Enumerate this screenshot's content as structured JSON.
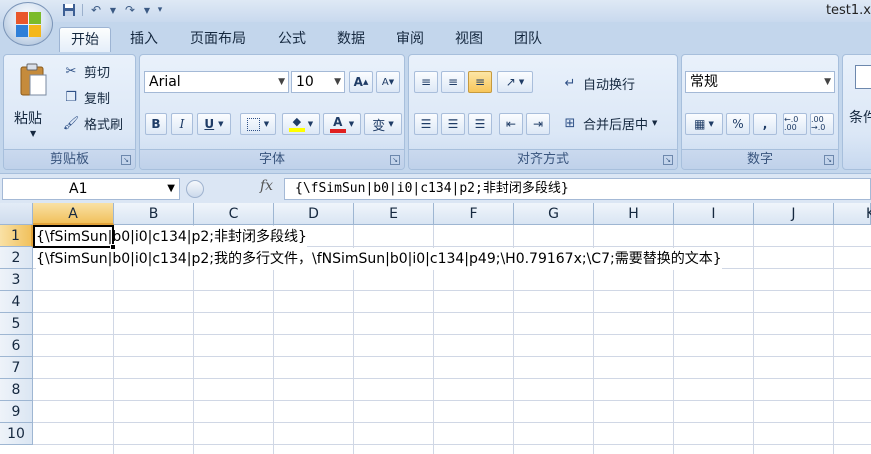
{
  "window": {
    "title": "test1.x"
  },
  "tabs": [
    {
      "label": "开始",
      "active": true
    },
    {
      "label": "插入"
    },
    {
      "label": "页面布局"
    },
    {
      "label": "公式"
    },
    {
      "label": "数据"
    },
    {
      "label": "审阅"
    },
    {
      "label": "视图"
    },
    {
      "label": "团队"
    }
  ],
  "clipboard": {
    "paste": "粘贴",
    "cut": "剪切",
    "copy": "复制",
    "format_painter": "格式刷",
    "label": "剪贴板"
  },
  "font": {
    "name": "Arial",
    "size": "10",
    "bold": "B",
    "italic": "I",
    "underline": "U",
    "font_color_glyph": "A",
    "phonetic_glyph": "变",
    "grow_glyph": "A",
    "shrink_glyph": "A",
    "label": "字体"
  },
  "alignment": {
    "wrap_text": "自动换行",
    "merge_center": "合并后居中",
    "label": "对齐方式"
  },
  "number": {
    "format": "常规",
    "percent": "%",
    "comma": ",",
    "inc_decimal": "←.0 .00",
    "dec_decimal": ".00 →.0",
    "label": "数字"
  },
  "styles": {
    "conditional": "条件"
  },
  "formula_bar": {
    "name_box": "A1",
    "fx": "fx",
    "content": "{\\fSimSun|b0|i0|c134|p2;非封闭多段线}"
  },
  "grid": {
    "columns": [
      "A",
      "B",
      "C",
      "D",
      "E",
      "F",
      "G",
      "H",
      "I",
      "J",
      "K"
    ],
    "rows": [
      "1",
      "2",
      "3",
      "4",
      "5",
      "6",
      "7",
      "8",
      "9",
      "10"
    ],
    "cells": {
      "A1": "{\\fSimSun|b0|i0|c134|p2;非封闭多段线}",
      "A2": "{\\fSimSun|b0|i0|c134|p2;我的多行文件，\\fNSimSun|b0|i0|c134|p49;\\H0.79167x;\\C7;需要替换的文本}"
    }
  },
  "colors": {
    "accent": "#f1c15d",
    "ribbon": "#c3d6ec",
    "gridline": "#d0d7e5",
    "font_color": "#e02020",
    "highlight": "#ffff00"
  }
}
